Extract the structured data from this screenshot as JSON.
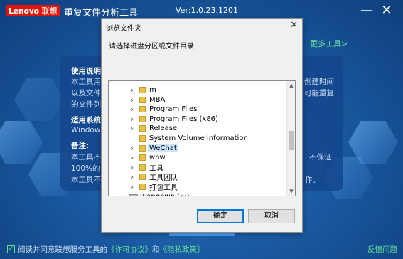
{
  "app": {
    "logo_text": "Lenovo",
    "logo_cn": "联想",
    "title": "重复文件分析工具",
    "version": "Ver:1.0.23.1201",
    "minimize_label": "—",
    "close_label": "✕",
    "more_tools": "更多工具>"
  },
  "background": {
    "usage_heading": "使用说明",
    "usage_line1_left": "本工具用",
    "usage_line1_right": "创建时间",
    "usage_line2_left": "以及文件",
    "usage_line2_right": "可能重复",
    "usage_line3_left": "的文件列",
    "system_heading": "适用系统",
    "system_text": "Window",
    "notes_heading": "备注:",
    "notes_line1_left": "本工具不",
    "notes_line1_right": "不保证",
    "notes_line2_left": "100%的",
    "notes_line3_left": "本工具不",
    "notes_line3_right": "作。"
  },
  "footer": {
    "agree_prefix": "阅读并同意联想服务工具的",
    "license_link": "《许可协议》",
    "and": "和",
    "privacy_link": "《隐私政策》",
    "feedback": "反馈问题"
  },
  "dialog": {
    "title": "浏览文件夹",
    "close": "✕",
    "prompt": "请选择磁盘分区或文件目录",
    "ok": "确定",
    "cancel": "取消",
    "tree_items": [
      {
        "label": "m"
      },
      {
        "label": "MBA"
      },
      {
        "label": "Program Files"
      },
      {
        "label": "Program Files (x86)"
      },
      {
        "label": "Release"
      },
      {
        "label": "System Volume Information"
      },
      {
        "label": "WeChat",
        "selected": true
      },
      {
        "label": "whw"
      },
      {
        "label": "工具"
      },
      {
        "label": "工具团队"
      },
      {
        "label": "打包工具"
      },
      {
        "label": "Wanghwh (E:)"
      }
    ]
  }
}
